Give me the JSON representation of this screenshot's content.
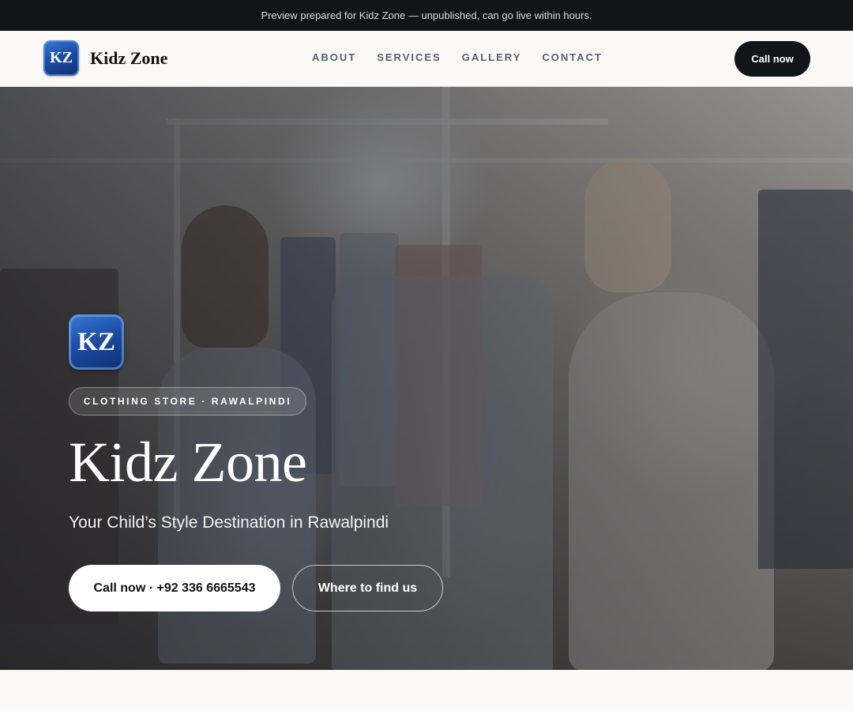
{
  "preview_bar": {
    "text": "Preview prepared for Kidz Zone — unpublished, can go live within hours."
  },
  "header": {
    "logo_text": "KZ",
    "brand_name": "Kidz Zone",
    "nav": [
      "ABOUT",
      "SERVICES",
      "GALLERY",
      "CONTACT"
    ],
    "cta_label": "Call now"
  },
  "hero": {
    "logo_text": "KZ",
    "tag": "CLOTHING STORE · RAWALPINDI",
    "title": "Kidz Zone",
    "subtitle": "Your Child’s Style Destination in Rawalpindi",
    "primary_button": "Call now · +92 336 6665543",
    "secondary_button": "Where to find us",
    "image": "photo of two women browsing clothes on a rack in a boutique"
  },
  "colors": {
    "topbar": "#121419",
    "header_bg": "#faf9f6",
    "cta_bg": "#111418",
    "logo_blue": "#1c4ea6"
  }
}
